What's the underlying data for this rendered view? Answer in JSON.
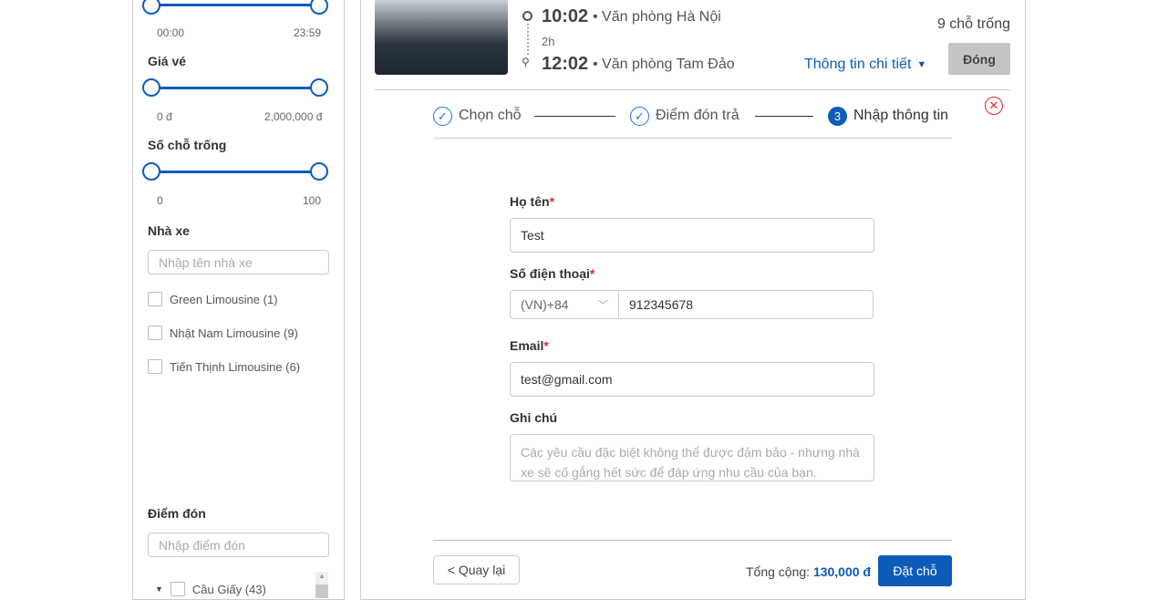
{
  "filters": {
    "time": {
      "min_label": "00:00",
      "max_label": "23:59",
      "range": [
        "00:00",
        "23:59"
      ]
    },
    "price": {
      "title": "Giá vé",
      "min_label": "0 đ",
      "max_label": "2,000,000 đ",
      "range": [
        0,
        2000000
      ]
    },
    "seats": {
      "title": "Số chỗ trống",
      "min_label": "0",
      "max_label": "100",
      "range": [
        0,
        100
      ]
    },
    "operator": {
      "title": "Nhà xe",
      "placeholder": "Nhập tên nhà xe",
      "items": [
        {
          "label": "Green Limousine (1)"
        },
        {
          "label": "Nhật Nam Limousine (9)"
        },
        {
          "label": "Tiến Thịnh Limousine (6)"
        }
      ]
    },
    "pickup": {
      "title": "Điểm đón",
      "placeholder": "Nhập điểm đón",
      "items": [
        {
          "label": "Cầu Giấy (43)"
        }
      ]
    }
  },
  "trip": {
    "depart_time": "10:02",
    "depart_place": "• Văn phòng Hà Nội",
    "duration": "2h",
    "arrive_time": "12:02",
    "arrive_place": "• Văn phòng Tam Đảo",
    "seats_left": "9 chỗ trống",
    "details_link": "Thông tin chi tiết",
    "close_button": "Đóng"
  },
  "steps": [
    {
      "label": "Chọn chỗ",
      "status": "done"
    },
    {
      "label": "Điểm đón trả",
      "status": "done"
    },
    {
      "number": "3",
      "label": "Nhập thông tin",
      "status": "active"
    }
  ],
  "form": {
    "name": {
      "label": "Họ tên",
      "value": "Test"
    },
    "phone": {
      "label": "Số điện thoại",
      "country": "(VN)+84",
      "value": "912345678"
    },
    "email": {
      "label": "Email",
      "value": "test@gmail.com"
    },
    "note": {
      "label": "Ghi chú",
      "placeholder": "Các yêu cầu đặc biệt không thể được đảm bảo - nhưng nhà xe sẽ cố gắng hết sức để đáp ứng nhu cầu của bạn."
    },
    "required_mark": "*"
  },
  "footer": {
    "back": "< Quay lại",
    "total_label": "Tổng cộng:",
    "total_value": "130,000 đ",
    "submit": "Đặt chỗ"
  },
  "colors": {
    "accent": "#0d5cba",
    "required": "#e0252f",
    "close": "#e0252f"
  }
}
